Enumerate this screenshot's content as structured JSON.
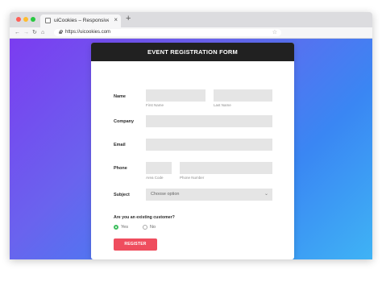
{
  "browser": {
    "tab_title": "uiCookies – Responsive HTML",
    "tab_close": "×",
    "new_tab": "+",
    "nav_back": "←",
    "nav_forward": "→",
    "nav_reload": "↻",
    "nav_home": "⌂",
    "url": "https://uicookies.com",
    "star": "☆"
  },
  "form": {
    "title": "EVENT REGISTRATION FORM",
    "name": {
      "label": "Name",
      "first_hint": "First Name",
      "last_hint": "Last Name"
    },
    "company": {
      "label": "Company"
    },
    "email": {
      "label": "Email"
    },
    "phone": {
      "label": "Phone",
      "area_hint": "Area Code",
      "number_hint": "Phone Number"
    },
    "subject": {
      "label": "Subject",
      "selected": "Choose option",
      "chevron": "⌄"
    },
    "customer_question": "Are you an existing customer?",
    "options": {
      "yes": "Yes",
      "no": "No",
      "selected": "yes"
    },
    "submit_label": "REGISTER"
  },
  "colors": {
    "header_bg": "#212121",
    "button_bg": "#ef4d5e",
    "radio_selected": "#3fbf5f",
    "gradient_start": "#7b3cf0",
    "gradient_end": "#3fb3f5"
  },
  "icons": [
    "close-icon",
    "plus-icon",
    "back-arrow-icon",
    "forward-arrow-icon",
    "reload-icon",
    "home-icon",
    "lock-icon",
    "star-icon",
    "chevron-down-icon"
  ]
}
